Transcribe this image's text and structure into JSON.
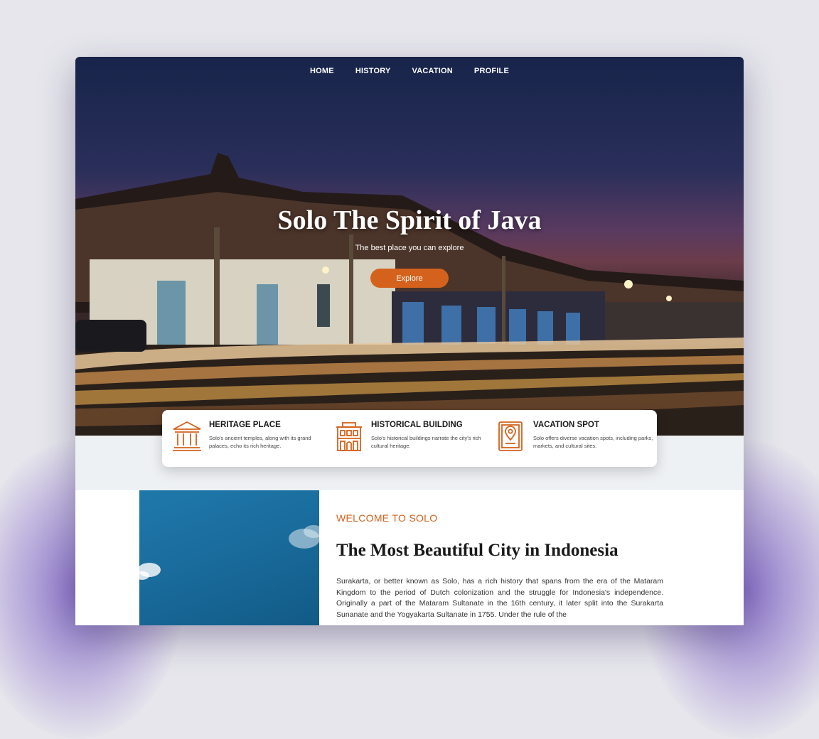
{
  "nav": {
    "items": [
      "HOME",
      "HISTORY",
      "VACATION",
      "PROFILE"
    ]
  },
  "hero": {
    "title": "Solo The Spirit of Java",
    "subtitle": "The best place you can explore",
    "button_label": "Explore"
  },
  "features": [
    {
      "title": "HERITAGE PLACE",
      "description": "Solo's ancient temples, along with its grand palaces, echo its rich heritage.",
      "icon": "temple-icon"
    },
    {
      "title": "HISTORICAL BUILDING",
      "description": "Solo's historical buildings narrate the city's rich cultural heritage.",
      "icon": "building-icon"
    },
    {
      "title": "VACATION SPOT",
      "description": "Solo offers diverse vacation spots, including parks, markets, and cultural sites.",
      "icon": "map-pin-icon"
    }
  ],
  "about": {
    "tag": "WELCOME TO SOLO",
    "title": "The Most Beautiful City in Indonesia",
    "body": "Surakarta, or better known as Solo, has a rich history that spans from the era of the Mataram Kingdom to the period of Dutch colonization and the struggle for Indonesia's independence. Originally a part of the Mataram Sultanate in the 16th century, it later split into the Surakarta Sunanate and the Yogyakarta Sultanate in 1755. Under the rule of the"
  },
  "colors": {
    "accent": "#d4621c",
    "background": "#e6e6ec",
    "band": "#eef1f4"
  }
}
